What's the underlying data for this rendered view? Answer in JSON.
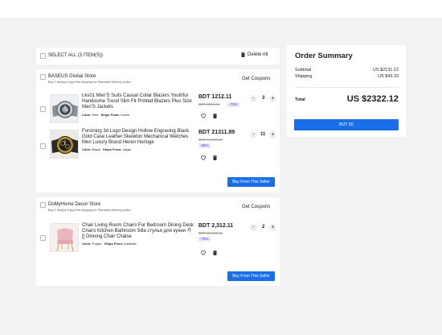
{
  "cart_header": {
    "select_all_label": "SELECT ALL (3 ITEM(S))",
    "delete_all_label": "Delete All"
  },
  "stores": [
    {
      "name": "BASEUS Global Store",
      "shipping_note": "Buy 1 item(s) enjoy free shipping for Standard delivery option",
      "coupons_label": "Get Coupons",
      "buy_label": "Buy From This Seller",
      "items": [
        {
          "title": "Lks01 Men'S Suits Casual Collar Blazers Youthful Handsome Trend Slim Fit Printed Blazers Plus Size Men'S Jackets",
          "color_label": "Color:",
          "color": "Red",
          "ships_label": "Ships From:",
          "ships_from": "Korea",
          "price": "BDT 1212.11",
          "original_price": "BDT 2213.21",
          "discount": "-73%",
          "qty": "3"
        },
        {
          "title": "Forsining 3d Logo Design Hollow Engraving Black Gold Case Leather Skeleton Mechanical Watches Men Luxury Brand Heren Horloge",
          "color_label": "Color:",
          "color": "Black",
          "ships_label": "Ships From:",
          "ships_from": "Japan",
          "price": "BDT 21311.89",
          "original_price": "BDT 24,589.27",
          "discount": "-68%",
          "qty": "11"
        }
      ]
    },
    {
      "name": "DoMyHome Decor Store",
      "shipping_note": "Buy 1 item(s) enjoy free shipping for Standard delivery option",
      "coupons_label": "Get Coupons",
      "buy_label": "Buy From This Seller",
      "items": [
        {
          "title": "Chair Living Room Chairs For Bedroom Dining Desk Chairs Kitchen Bathroom Silla стулья для кухни 가 [] Dinning Chair Chaise",
          "color_label": "Color:",
          "color": "Purple",
          "ships_label": "Ships From:",
          "ships_from": "Australia",
          "price": "BDT 2,312.11",
          "original_price": "BDT 12,123.11",
          "discount": "-78%",
          "qty": "2"
        }
      ]
    }
  ],
  "summary": {
    "title": "Order Summary",
    "subtotal_label": "Subtotal",
    "subtotal": "US $2131.12",
    "shipping_label": "Shipping",
    "shipping": "US $43.33",
    "total_label": "Total",
    "total": "US $2322.12",
    "buy_label": "BUY (0)"
  },
  "icons": {
    "trash": "trash-icon",
    "heart": "heart-icon",
    "minus": "minus-icon",
    "plus": "plus-icon"
  },
  "colors": {
    "accent": "#1a6fe8",
    "discount_badge": "#e9e7fb"
  }
}
